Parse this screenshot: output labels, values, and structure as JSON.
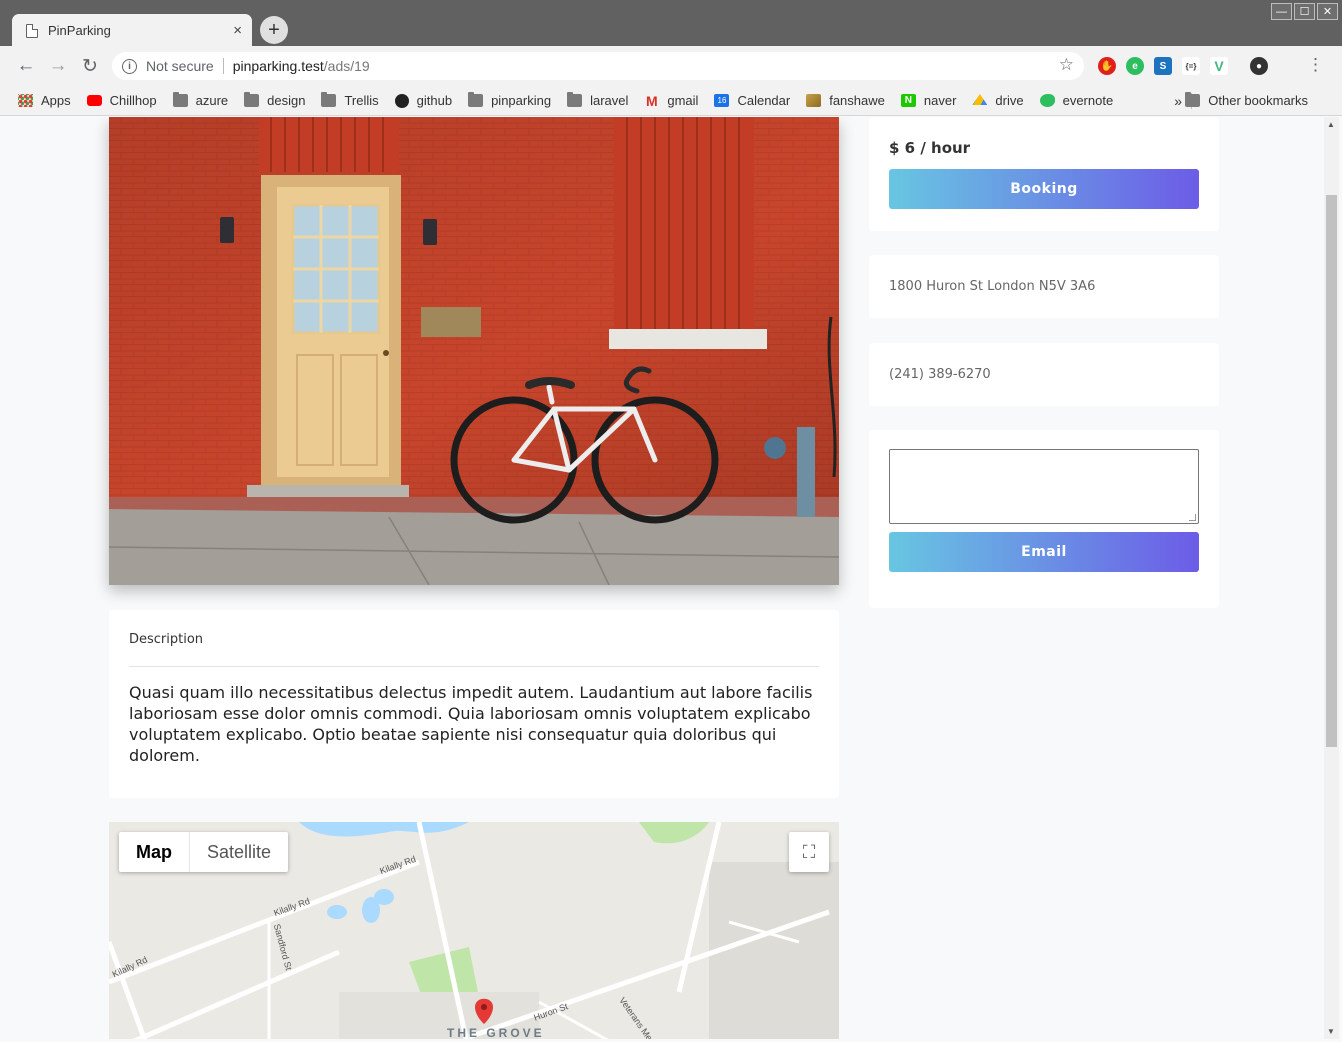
{
  "browser": {
    "tab_title": "PinParking",
    "tab_close": "×",
    "new_tab": "+",
    "security_label": "Not secure",
    "url_host": "pinparking.test",
    "url_path": "/ads/19",
    "window_controls": [
      "—",
      "☐",
      "✕"
    ]
  },
  "bookmarks": {
    "items": [
      {
        "label": "Apps",
        "icon": "apps-grid-icon",
        "color": "#e53935"
      },
      {
        "label": "Chillhop",
        "icon": "youtube-icon",
        "color": "#ff0000"
      },
      {
        "label": "azure",
        "icon": "folder-icon",
        "color": "#7a7a7a"
      },
      {
        "label": "design",
        "icon": "folder-icon",
        "color": "#7a7a7a"
      },
      {
        "label": "Trellis",
        "icon": "folder-icon",
        "color": "#7a7a7a"
      },
      {
        "label": "github",
        "icon": "github-icon",
        "color": "#222222"
      },
      {
        "label": "pinparking",
        "icon": "folder-icon",
        "color": "#7a7a7a"
      },
      {
        "label": "laravel",
        "icon": "folder-icon",
        "color": "#7a7a7a"
      },
      {
        "label": "gmail",
        "icon": "gmail-icon",
        "color": "#d93025"
      },
      {
        "label": "Calendar",
        "icon": "calendar-icon",
        "color": "#1a73e8"
      },
      {
        "label": "fanshawe",
        "icon": "fanshawe-icon",
        "color": "#c8a24a"
      },
      {
        "label": "naver",
        "icon": "naver-icon",
        "color": "#1ec800"
      },
      {
        "label": "drive",
        "icon": "drive-icon",
        "color": "#fbbc04"
      },
      {
        "label": "evernote",
        "icon": "evernote-icon",
        "color": "#2dbe60"
      }
    ],
    "overflow": "»",
    "other": "Other bookmarks"
  },
  "listing": {
    "price": "$ 6 / hour",
    "booking_label": "Booking",
    "address": "1800 Huron St London N5V 3A6",
    "phone": "(241) 389-6270",
    "email_label": "Email",
    "description_title": "Description",
    "description": "Quasi quam illo necessitatibus delectus impedit autem. Laudantium aut labore facilis laboriosam esse dolor omnis commodi. Quia laboriosam omnis voluptatem explicabo voluptatem explicabo. Optio beatae sapiente nisi consequatur quia doloribus qui dolorem."
  },
  "map": {
    "map_label": "Map",
    "satellite_label": "Satellite",
    "streets": [
      "Kilally Rd",
      "Kilally Rd",
      "Kilally Rd",
      "Sandford St",
      "Huron St",
      "Veterans Mem"
    ],
    "place": "THE GROVE"
  },
  "colors": {
    "button_gradient_start": "#68c6e2",
    "button_gradient_end": "#6c5ce7",
    "marker": "#e53935"
  }
}
